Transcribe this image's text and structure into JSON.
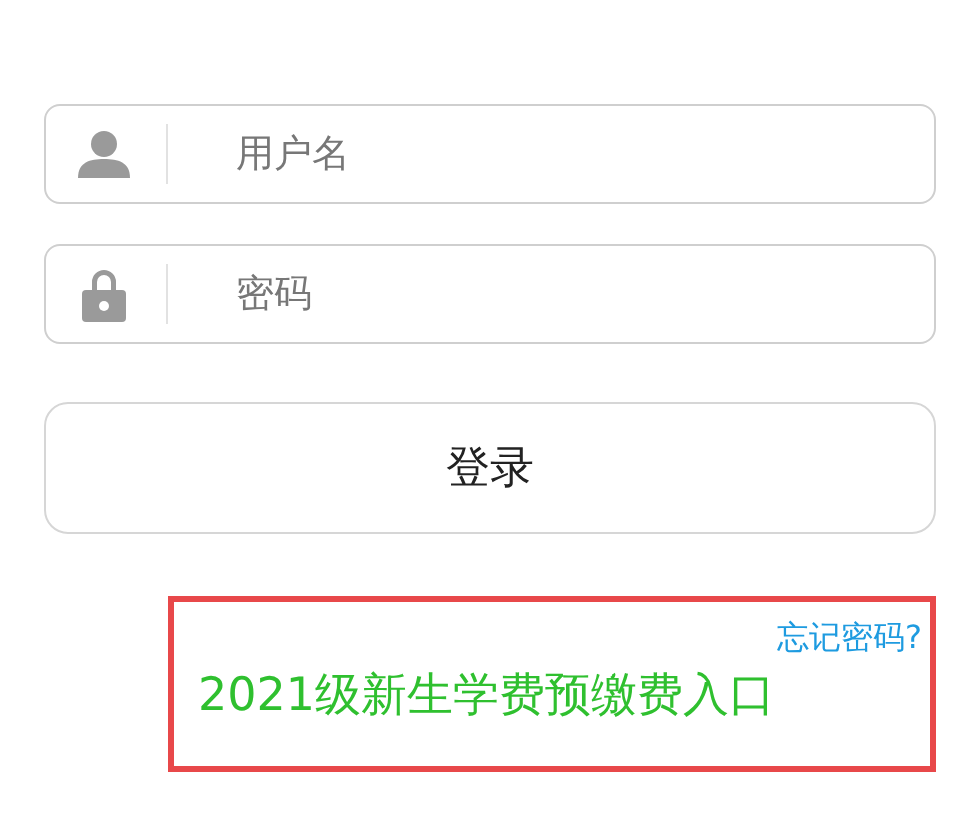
{
  "fields": [
    {
      "kind": "user",
      "placeholder": "用户名"
    },
    {
      "kind": "lock",
      "placeholder": "密码"
    }
  ],
  "login_button": "登录",
  "forgot_link": "忘记密码?",
  "fee_link": "2021级新生学费预缴费入口"
}
